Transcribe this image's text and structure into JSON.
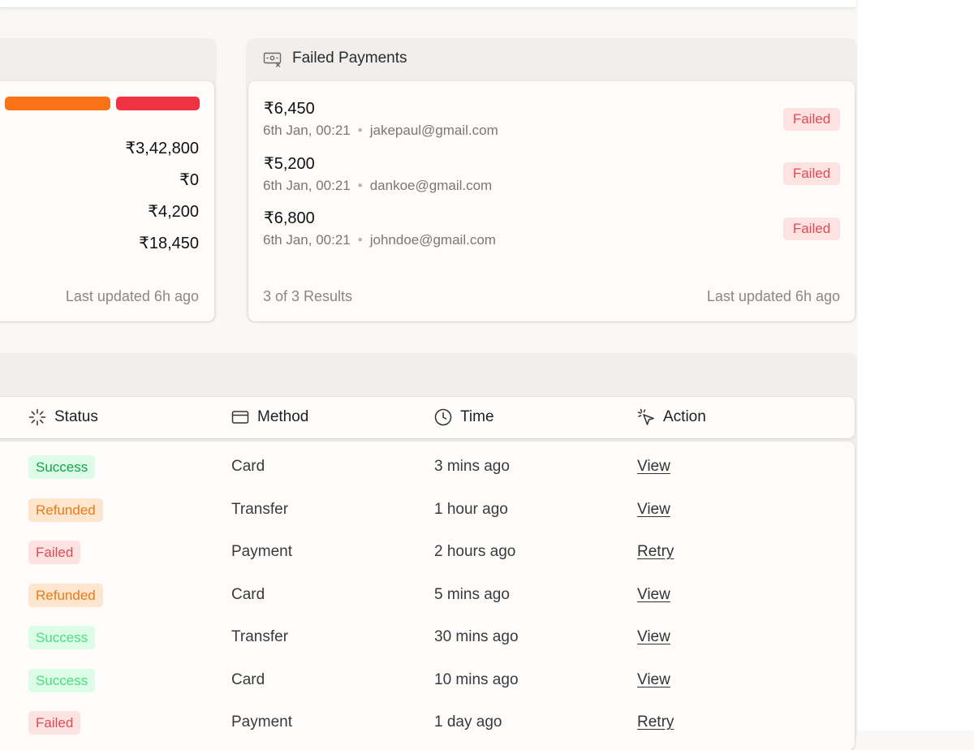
{
  "summary": {
    "amounts": [
      "₹3,42,800",
      "₹0",
      "₹4,200",
      "₹18,450"
    ],
    "last_updated": "Last updated 6h ago",
    "bar_colors": [
      "#f97316",
      "#ef3340"
    ]
  },
  "failed_payments": {
    "title": "Failed Payments",
    "icon": "money-x-icon",
    "items": [
      {
        "amount": "₹6,450",
        "date": "6th Jan, 00:21",
        "email": "jakepaul@gmail.com",
        "status": "Failed"
      },
      {
        "amount": "₹5,200",
        "date": "6th Jan, 00:21",
        "email": "dankoe@gmail.com",
        "status": "Failed"
      },
      {
        "amount": "₹6,800",
        "date": "6th Jan, 00:21",
        "email": "johndoe@gmail.com",
        "status": "Failed"
      }
    ],
    "results": "3 of 3 Results",
    "last_updated": "Last updated 6h ago"
  },
  "table": {
    "columns": [
      {
        "label": "Status",
        "icon": "loader-icon"
      },
      {
        "label": "Method",
        "icon": "card-icon"
      },
      {
        "label": "Time",
        "icon": "clock-icon"
      },
      {
        "label": "Action",
        "icon": "pointer-click-icon"
      }
    ],
    "rows": [
      {
        "status": "Success",
        "method": "Card",
        "time": "3 mins ago",
        "action": "View"
      },
      {
        "status": "Refunded",
        "method": "Transfer",
        "time": "1 hour ago",
        "action": "View"
      },
      {
        "status": "Failed",
        "method": "Payment",
        "time": "2 hours ago",
        "action": "Retry"
      },
      {
        "status": "Refunded",
        "method": "Card",
        "time": "5 mins ago",
        "action": "View"
      },
      {
        "status": "Success",
        "method": "Transfer",
        "time": "30 mins ago",
        "action": "View"
      },
      {
        "status": "Success",
        "method": "Card",
        "time": "10 mins ago",
        "action": "View"
      },
      {
        "status": "Failed",
        "method": "Payment",
        "time": "1 day ago",
        "action": "Retry"
      }
    ]
  },
  "colors": {
    "success": "#16a34a",
    "refunded": "#ea7a18",
    "failed": "#e04b55"
  }
}
